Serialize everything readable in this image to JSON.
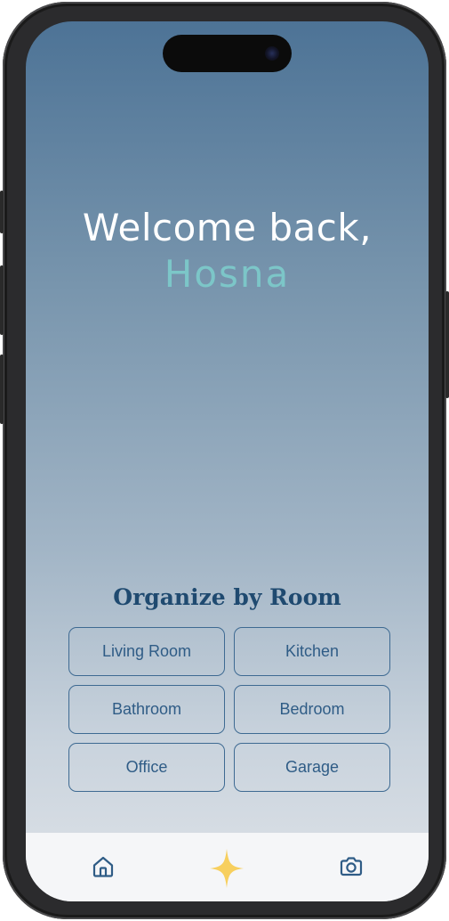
{
  "greeting": {
    "line1": "Welcome back,",
    "name": "Hosna"
  },
  "rooms": {
    "title": "Organize by Room",
    "items": [
      {
        "label": "Living Room"
      },
      {
        "label": "Kitchen"
      },
      {
        "label": "Bathroom"
      },
      {
        "label": "Bedroom"
      },
      {
        "label": "Office"
      },
      {
        "label": "Garage"
      }
    ]
  },
  "tabbar": {
    "items": [
      {
        "icon": "home-icon"
      },
      {
        "icon": "sparkle-icon"
      },
      {
        "icon": "camera-icon"
      }
    ]
  },
  "colors": {
    "accent_name": "#7cc6c8",
    "title": "#1f4a70",
    "button_border": "#3e6a92",
    "sparkle": "#f7cf5e",
    "icon": "#2f5c86"
  }
}
